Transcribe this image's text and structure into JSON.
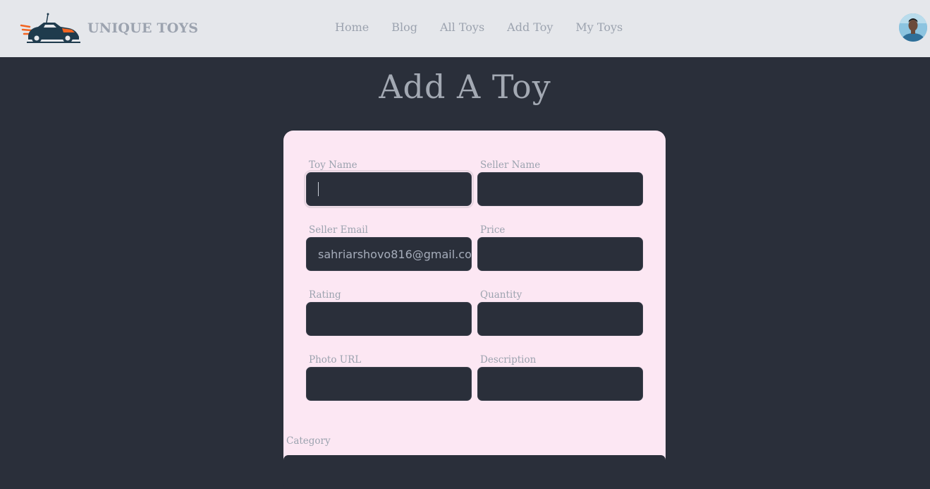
{
  "brand": {
    "name": "UNIQUE TOYS",
    "logo_icon": "race-car-logo-icon"
  },
  "nav": {
    "links": [
      "Home",
      "Blog",
      "All Toys",
      "Add Toy",
      "My Toys"
    ]
  },
  "user": {
    "avatar_icon": "user-avatar"
  },
  "page": {
    "title": "Add A Toy"
  },
  "form": {
    "toy_name": {
      "label": "Toy Name",
      "value": ""
    },
    "seller_name": {
      "label": "Seller Name",
      "value": ""
    },
    "seller_email": {
      "label": "Seller Email",
      "value": "sahriarshovo816@gmail.co"
    },
    "price": {
      "label": "Price",
      "value": ""
    },
    "rating": {
      "label": "Rating",
      "value": ""
    },
    "quantity": {
      "label": "Quantity",
      "value": ""
    },
    "photo_url": {
      "label": "Photo URL",
      "value": ""
    },
    "description": {
      "label": "Description",
      "value": ""
    },
    "category": {
      "label": "Category",
      "value": ""
    }
  },
  "colors": {
    "navbar_bg": "#e5e7eb",
    "page_bg": "#2a2f3a",
    "card_bg": "#fce7f3",
    "muted_text": "#9ca3af",
    "logo_accent": "#f26522",
    "logo_dark": "#1f3b4d"
  }
}
